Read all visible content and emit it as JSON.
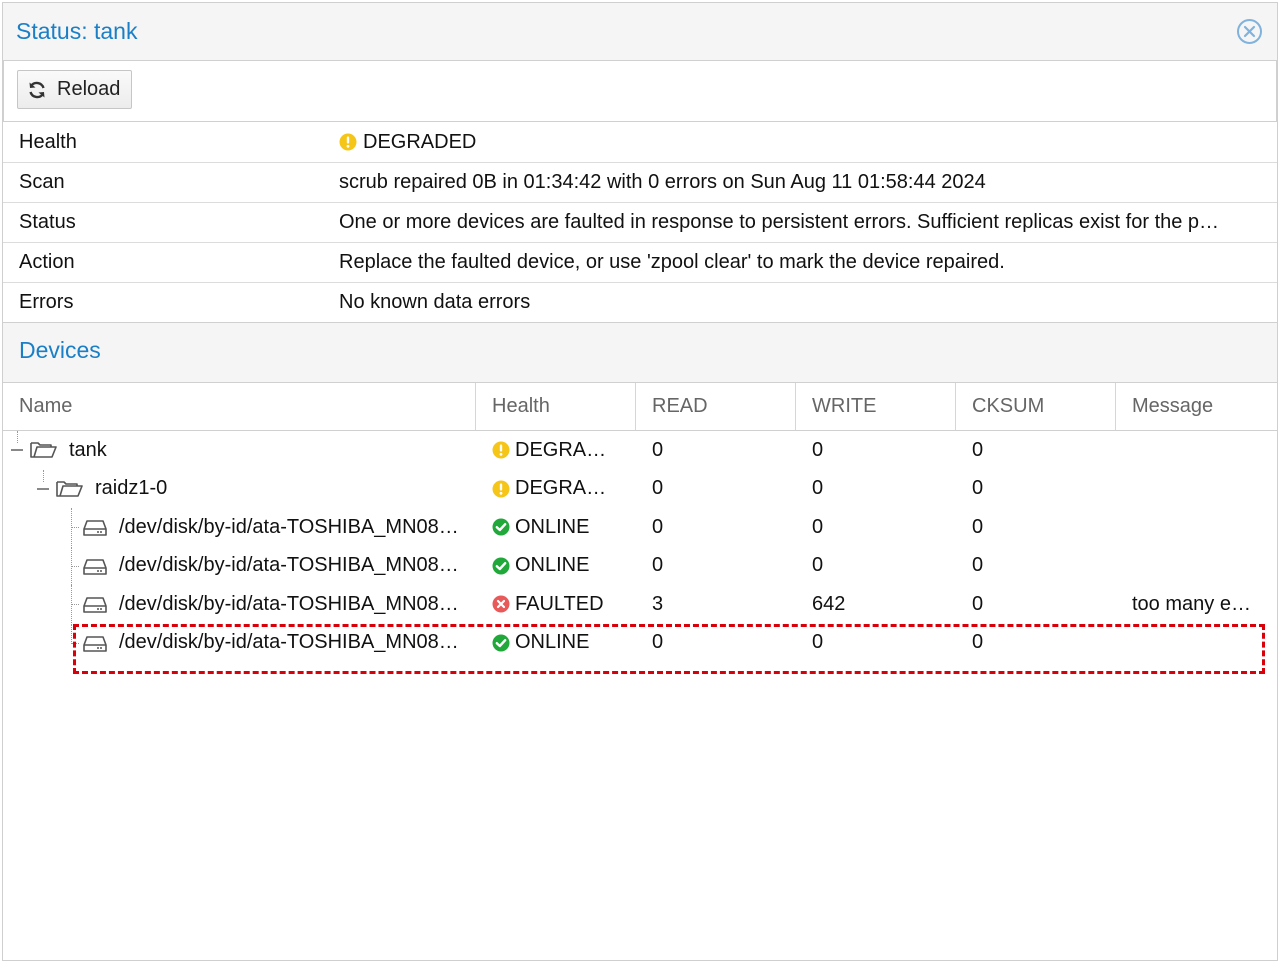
{
  "window": {
    "title": "Status: tank"
  },
  "toolbar": {
    "reload_label": "Reload"
  },
  "properties": [
    {
      "key": "Health",
      "value": "DEGRADED",
      "icon": "warning-icon"
    },
    {
      "key": "Scan",
      "value": "scrub repaired 0B in 01:34:42 with 0 errors on Sun Aug 11 01:58:44 2024"
    },
    {
      "key": "Status",
      "value": "One or more devices are faulted in response to persistent errors. Sufficient replicas exist for the p…"
    },
    {
      "key": "Action",
      "value": "Replace the faulted device, or use 'zpool clear' to mark the device repaired."
    },
    {
      "key": "Errors",
      "value": "No known data errors"
    }
  ],
  "devices_section": {
    "title": "Devices"
  },
  "grid": {
    "columns": [
      "Name",
      "Health",
      "READ",
      "WRITE",
      "CKSUM",
      "Message"
    ],
    "rows": [
      {
        "name": "tank",
        "type": "pool",
        "health": "DEGRA…",
        "health_icon": "warning-icon",
        "read": "0",
        "write": "0",
        "cksum": "0",
        "message": ""
      },
      {
        "name": "raidz1-0",
        "type": "vdev",
        "health": "DEGRA…",
        "health_icon": "warning-icon",
        "read": "0",
        "write": "0",
        "cksum": "0",
        "message": ""
      },
      {
        "name": "/dev/disk/by-id/ata-TOSHIBA_MN08…",
        "type": "disk",
        "health": "ONLINE",
        "health_icon": "check-circle-icon",
        "read": "0",
        "write": "0",
        "cksum": "0",
        "message": ""
      },
      {
        "name": "/dev/disk/by-id/ata-TOSHIBA_MN08…",
        "type": "disk",
        "health": "ONLINE",
        "health_icon": "check-circle-icon",
        "read": "0",
        "write": "0",
        "cksum": "0",
        "message": ""
      },
      {
        "name": "/dev/disk/by-id/ata-TOSHIBA_MN08…",
        "type": "disk",
        "health": "FAULTED",
        "health_icon": "error-circle-icon",
        "read": "3",
        "write": "642",
        "cksum": "0",
        "message": "too many e…"
      },
      {
        "name": "/dev/disk/by-id/ata-TOSHIBA_MN08…",
        "type": "disk",
        "health": "ONLINE",
        "health_icon": "check-circle-icon",
        "read": "0",
        "write": "0",
        "cksum": "0",
        "message": ""
      }
    ]
  },
  "colors": {
    "accent": "#1a7fc6",
    "warning": "#f5c518",
    "ok": "#21a83a",
    "error": "#e85a5a",
    "highlight": "#d9000a"
  }
}
